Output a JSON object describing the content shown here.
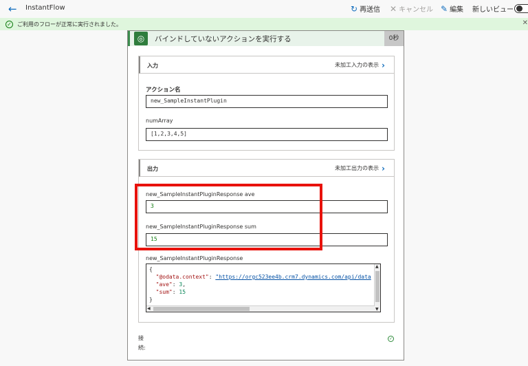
{
  "topbar": {
    "app_title": "InstantFlow",
    "resend_label": "再送信",
    "cancel_label": "キャンセル",
    "edit_label": "編集",
    "new_view_label": "新しいビュー"
  },
  "banner": {
    "message": "ご利用のフローが正常に実行されました。"
  },
  "action_card": {
    "title": "バインドしていないアクションを実行する",
    "duration": "0秒",
    "input_section": {
      "title": "入力",
      "raw_link": "未加工入力の表示",
      "fields": [
        {
          "label": "アクション名",
          "value": "new_SampleInstantPlugin"
        },
        {
          "label": "numArray",
          "value": "[1,2,3,4,5]"
        }
      ]
    },
    "output_section": {
      "title": "出力",
      "raw_link": "未加工出力の表示",
      "fields": [
        {
          "label": "new_SampleInstantPluginResponse ave",
          "value": "3"
        },
        {
          "label": "new_SampleInstantPluginResponse sum",
          "value": "15"
        }
      ],
      "response": {
        "label": "new_SampleInstantPluginResponse",
        "lines": {
          "open": "{",
          "context_key": "\"@odata.context\"",
          "context_value": "\"https://orgc523ee4b.crm7.dynamics.com/api/data",
          "ave_key": "\"ave\"",
          "ave_value": "3",
          "sum_key": "\"sum\"",
          "sum_value": "15",
          "close": "}"
        }
      }
    },
    "connection_label": "接続:"
  }
}
